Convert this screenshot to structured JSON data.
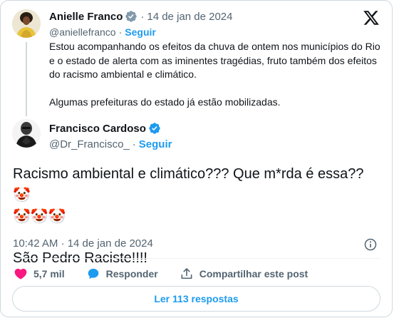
{
  "quoted": {
    "name": "Anielle Franco",
    "dot": "·",
    "date": "14 de jan de 2024",
    "handle": "@aniellefranco",
    "follow_sep": "·",
    "follow": "Seguir",
    "paragraph1": "Estou acompanhando os efeitos da chuva de ontem nos municípios do Rio e o estado de alerta com as iminentes tragédias, fruto também dos efeitos do racismo ambiental e climático.",
    "paragraph2": "Algumas prefeituras do estado já estão mobilizadas.",
    "verified_color": "#829aab"
  },
  "post": {
    "name": "Francisco Cardoso",
    "handle": "@Dr_Francisco_",
    "follow_sep": "·",
    "follow": "Seguir",
    "line1": "Racismo ambiental e climático??? Que m*rda é essa?? 🤡",
    "line2": "🤡🤡🤡",
    "line3": "São Pedro Raciste!!!!",
    "timestamp": "10:42 AM · 14 de jan de 2024",
    "verified_color": "#1d9bf0"
  },
  "actions": {
    "like_count": "5,7 mil",
    "reply_label": "Responder",
    "share_label": "Compartilhar este post"
  },
  "read_replies": "Ler 113 respostas",
  "colors": {
    "accent": "#1d9bf0",
    "like": "#f91880",
    "muted": "#536471"
  }
}
